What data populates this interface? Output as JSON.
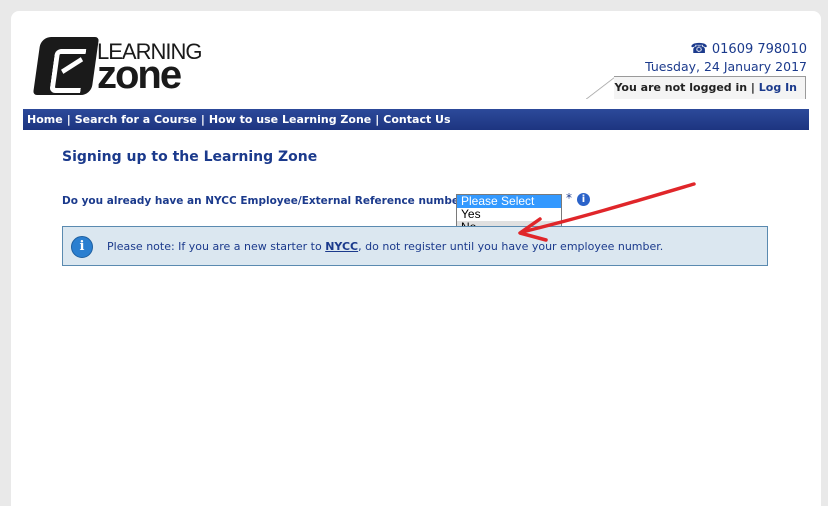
{
  "header": {
    "logo_top": "LEARNING",
    "logo_bottom": "zone",
    "phone": "01609 798010",
    "date": "Tuesday, 24 January 2017",
    "login_status": "You are not logged in |",
    "login_link": "Log In"
  },
  "nav": {
    "items": [
      "Home",
      "Search for a Course",
      "How to use Learning Zone",
      "Contact Us"
    ],
    "separator": "|"
  },
  "main": {
    "heading": "Signing up to the Learning Zone",
    "question": "Do you already have an NYCC Employee/External Reference number?",
    "select": {
      "options": [
        "Please Select",
        "Yes",
        "No"
      ],
      "selected": "Please Select",
      "hovered": "No"
    },
    "required_marker": "*",
    "info_glyph": "i",
    "notice": {
      "prefix": "Please note: If you are a new starter to ",
      "link": "NYCC",
      "suffix": ", do not register until you have your employee number."
    }
  },
  "colors": {
    "nav_bg": "#1d3580",
    "text_blue": "#1b3a8c",
    "notice_bg": "#dbe7f0",
    "select_highlight": "#3399ff",
    "arrow": "#e0262a"
  },
  "icons": {
    "phone": "telephone-icon",
    "info": "info-icon",
    "annotation": "red-arrow-annotation"
  }
}
